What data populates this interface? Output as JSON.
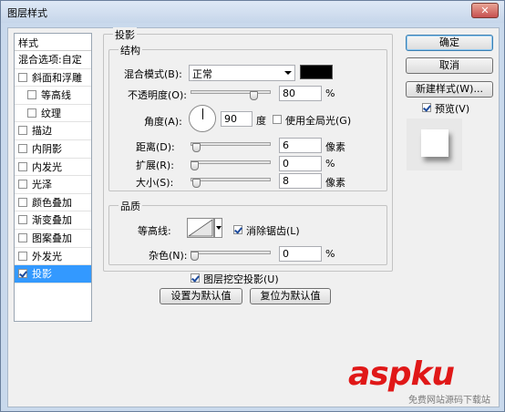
{
  "window": {
    "title": "图层样式",
    "close": "✕"
  },
  "left_list": {
    "header": "样式",
    "blend_options": "混合选项:自定",
    "items": [
      {
        "label": "斜面和浮雕",
        "checked": false,
        "indent": false
      },
      {
        "label": "等高线",
        "checked": false,
        "indent": true
      },
      {
        "label": "纹理",
        "checked": false,
        "indent": true
      },
      {
        "label": "描边",
        "checked": false,
        "indent": false
      },
      {
        "label": "内阴影",
        "checked": false,
        "indent": false
      },
      {
        "label": "内发光",
        "checked": false,
        "indent": false
      },
      {
        "label": "光泽",
        "checked": false,
        "indent": false
      },
      {
        "label": "颜色叠加",
        "checked": false,
        "indent": false
      },
      {
        "label": "渐变叠加",
        "checked": false,
        "indent": false
      },
      {
        "label": "图案叠加",
        "checked": false,
        "indent": false
      },
      {
        "label": "外发光",
        "checked": false,
        "indent": false
      },
      {
        "label": "投影",
        "checked": true,
        "indent": false,
        "selected": true
      }
    ]
  },
  "shadow": {
    "group_title": "投影",
    "structure_title": "结构",
    "blend_mode_label": "混合模式(B):",
    "blend_mode_value": "正常",
    "opacity_label": "不透明度(O):",
    "opacity_value": "80",
    "opacity_unit": "%",
    "opacity_fraction": 0.8,
    "angle_label": "角度(A):",
    "angle_value": "90",
    "angle_unit": "度",
    "global_light_label": "使用全局光(G)",
    "distance_label": "距离(D):",
    "distance_value": "6",
    "distance_unit": "像素",
    "spread_label": "扩展(R):",
    "spread_value": "0",
    "spread_unit": "%",
    "size_label": "大小(S):",
    "size_value": "8",
    "size_unit": "像素",
    "quality_title": "品质",
    "contour_label": "等高线:",
    "antialias_label": "消除锯齿(L)",
    "noise_label": "杂色(N):",
    "noise_value": "0",
    "noise_unit": "%",
    "knockout_label": "图层挖空投影(U)",
    "set_default": "设置为默认值",
    "reset_default": "复位为默认值",
    "shadow_color": "#000000"
  },
  "buttons": {
    "ok": "确定",
    "cancel": "取消",
    "new_style": "新建样式(W)...",
    "preview_label": "预览(V)"
  },
  "watermark": {
    "main": "aspku",
    "sub": "免费网站源码下载站"
  }
}
